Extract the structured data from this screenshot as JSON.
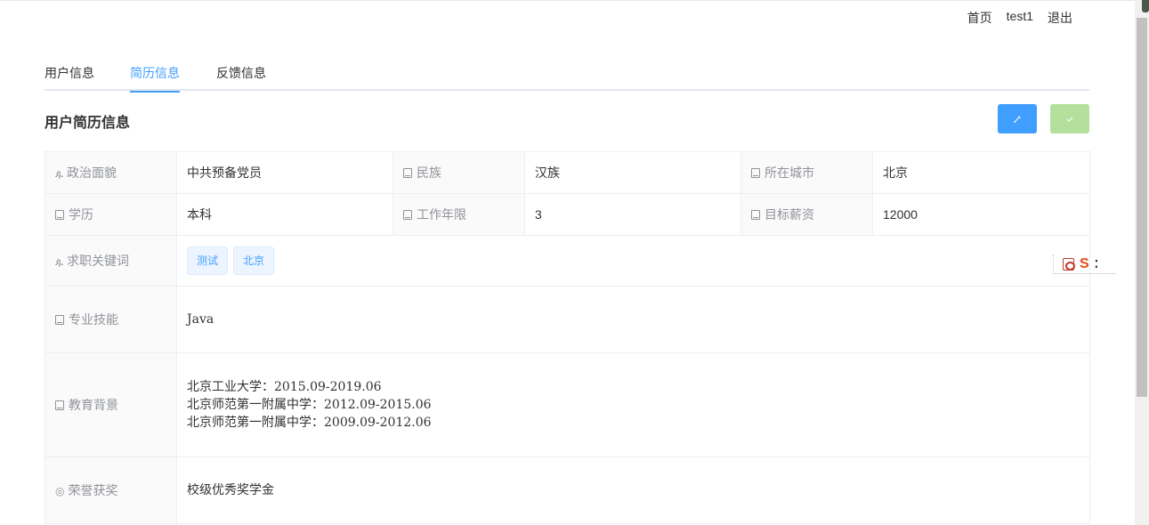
{
  "nav": {
    "home": "首页",
    "user": "test1",
    "logout": "退出"
  },
  "tabs": [
    "用户信息",
    "简历信息",
    "反馈信息"
  ],
  "section_title": "用户简历信息",
  "buttons": {
    "edit_icon": "pencil-icon",
    "confirm_icon": "check-icon"
  },
  "details": {
    "political": {
      "label": "政治面貌",
      "value": "中共预备党员"
    },
    "nation": {
      "label": "民族",
      "value": "汉族"
    },
    "city": {
      "label": "所在城市",
      "value": "北京"
    },
    "education": {
      "label": "学历",
      "value": "本科"
    },
    "work_years": {
      "label": "工作年限",
      "value": "3"
    },
    "salary": {
      "label": "目标薪资",
      "value": "12000"
    },
    "keywords": {
      "label": "求职关键词",
      "tags": [
        "测试",
        "北京"
      ]
    },
    "skills": {
      "label": "专业技能",
      "value": "Java"
    },
    "edu_background": {
      "label": "教育背景",
      "lines": [
        "北京工业大学：2015.09-2019.06",
        "北京师范第一附属中学：2012.09-2015.06",
        "北京师范第一附属中学：2009.09-2012.06"
      ]
    },
    "honors": {
      "label": "荣誉获奖",
      "value": "校级优秀奖学金"
    }
  },
  "colors": {
    "primary": "#409eff",
    "success_light": "#b3e19d",
    "label_bg": "#fafafa",
    "border": "#ebeef5"
  }
}
